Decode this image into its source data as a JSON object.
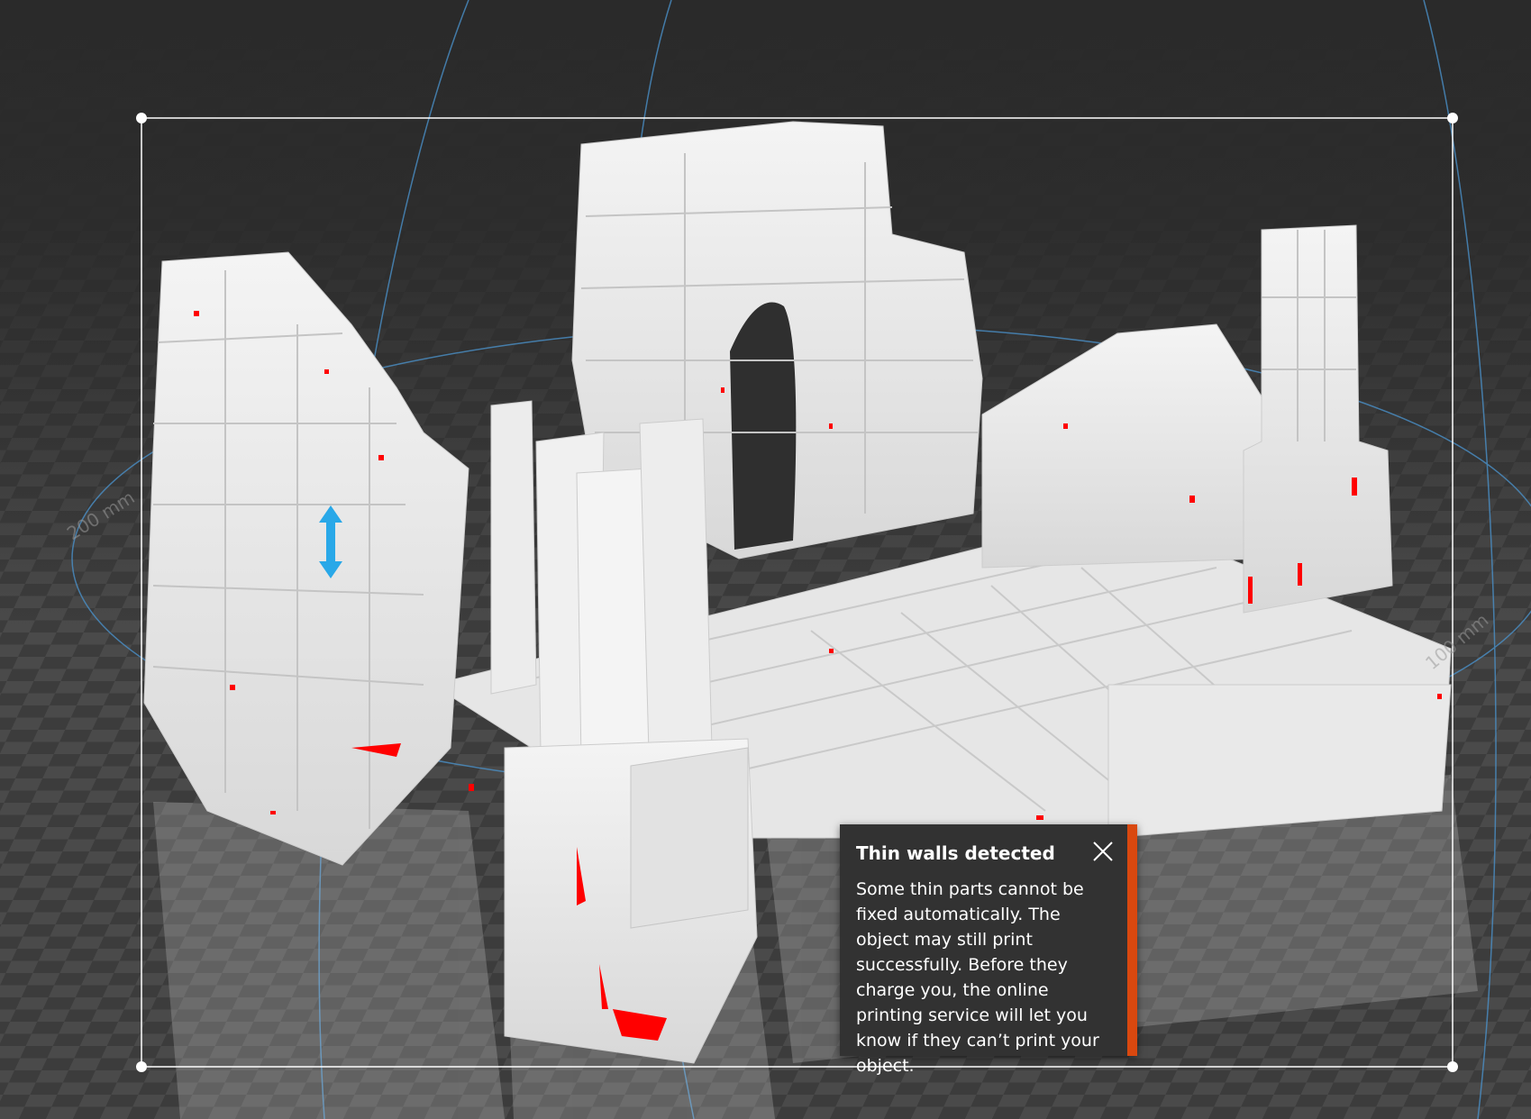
{
  "viewport": {
    "axis_label_left": "200 mm",
    "axis_label_right": "100 mm",
    "model": "ruins-model",
    "height_handle_icon": "vertical-resize-arrow-icon"
  },
  "notification": {
    "title": "Thin walls detected",
    "message": "Some thin parts cannot be fixed automatically. The object may still print successfully. Before they charge you, the online printing service will let you know if they can’t print your object.",
    "close_icon": "close-icon",
    "accent_color": "#d9480f"
  },
  "colors": {
    "background": "#2f2f2f",
    "model": "#eeeeee",
    "thin_wall_highlight": "#ff0000",
    "selection_box": "#ffffff",
    "rotation_ring": "#4a90c8"
  }
}
